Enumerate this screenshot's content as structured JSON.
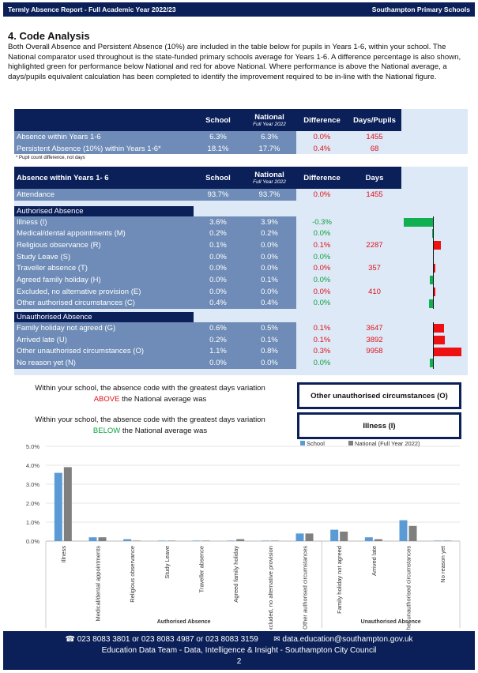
{
  "header": {
    "left": "Termly Absence Report - Full Academic Year 2022/23",
    "right": "Southampton Primary Schools"
  },
  "title": "4. Code Analysis",
  "intro": "Both Overall Absence and Persistent Absence (10%) are included in the table below for pupils in Years 1-6, within your school. The National comparator used throughout is the state-funded primary schools average for Years 1-6. A difference percentage is also shown, highlighted green for performance below National and red for above National. Where performance is above the National average, a days/pupils equivalent calculation has been completed to identify the improvement required to be in-line with the National figure.",
  "table1": {
    "headers": [
      "",
      "School",
      "National",
      "Difference",
      "Days/Pupils"
    ],
    "national_sub": "Full Year 2022",
    "rows": [
      {
        "label": "Absence within Years 1-6",
        "school": "6.3%",
        "national": "6.3%",
        "diff": "0.0%",
        "days": "1455",
        "status": "red"
      },
      {
        "label": "Persistent Absence (10%) within Years 1-6*",
        "school": "18.1%",
        "national": "17.7%",
        "diff": "0.4%",
        "days": "68",
        "status": "red"
      }
    ],
    "footnote": "* Pupil count difference, not days"
  },
  "table2": {
    "headers": [
      "Absence within Years 1- 6",
      "School",
      "National",
      "Difference",
      "Days"
    ],
    "national_sub": "Full Year 2022",
    "attendance": {
      "label": "Attendance",
      "school": "93.7%",
      "national": "93.7%",
      "diff": "0.0%",
      "days": "1455",
      "status": "red"
    },
    "authorised_title": "Authorised Absence",
    "authorised": [
      {
        "label": "Illness (I)",
        "school": "3.6%",
        "national": "3.9%",
        "diff": "-0.3%",
        "days": "",
        "status": "green",
        "bar": -0.3
      },
      {
        "label": "Medical/dental appointments (M)",
        "school": "0.2%",
        "national": "0.2%",
        "diff": "0.0%",
        "days": "",
        "status": "green",
        "bar": -0.005
      },
      {
        "label": "Religious observance (R)",
        "school": "0.1%",
        "national": "0.0%",
        "diff": "0.1%",
        "days": "2287",
        "status": "red",
        "bar": 0.07
      },
      {
        "label": "Study Leave (S)",
        "school": "0.0%",
        "national": "0.0%",
        "diff": "0.0%",
        "days": "",
        "status": "green",
        "bar": 0
      },
      {
        "label": "Traveller absence (T)",
        "school": "0.0%",
        "national": "0.0%",
        "diff": "0.0%",
        "days": "357",
        "status": "red",
        "bar": 0.01
      },
      {
        "label": "Agreed family holiday (H)",
        "school": "0.0%",
        "national": "0.1%",
        "diff": "0.0%",
        "days": "",
        "status": "green",
        "bar": -0.03
      },
      {
        "label": "Excluded, no alternative provision (E)",
        "school": "0.0%",
        "national": "0.0%",
        "diff": "0.0%",
        "days": "410",
        "status": "red",
        "bar": 0.01
      },
      {
        "label": "Other authorised circumstances (C)",
        "school": "0.4%",
        "national": "0.4%",
        "diff": "0.0%",
        "days": "",
        "status": "green",
        "bar": -0.04
      }
    ],
    "unauthorised_title": "Unauthorised Absence",
    "unauthorised": [
      {
        "label": "Family holiday not agreed (G)",
        "school": "0.6%",
        "national": "0.5%",
        "diff": "0.1%",
        "days": "3647",
        "status": "red",
        "bar": 0.1
      },
      {
        "label": "Arrived late (U)",
        "school": "0.2%",
        "national": "0.1%",
        "diff": "0.1%",
        "days": "3892",
        "status": "red",
        "bar": 0.11
      },
      {
        "label": "Other unauthorised circumstances (O)",
        "school": "1.1%",
        "national": "0.8%",
        "diff": "0.3%",
        "days": "9958",
        "status": "red",
        "bar": 0.28
      },
      {
        "label": "No reason yet (N)",
        "school": "0.0%",
        "national": "0.0%",
        "diff": "0.0%",
        "days": "",
        "status": "green",
        "bar": -0.03
      }
    ]
  },
  "callouts": {
    "line1": "Within your school, the absence code with the greatest days variation",
    "above_word": "ABOVE",
    "below_word": "BELOW",
    "tail": "the National average was",
    "above_value": "Other unauthorised circumstances (O)",
    "below_value": "Illness (I)"
  },
  "colors": {
    "navy": "#0b2059",
    "red": "#e0101a",
    "green": "#10a040",
    "school": "#5b9bd5",
    "national": "#7f7f7f"
  },
  "chart_data": {
    "type": "bar",
    "ylim": [
      0,
      5
    ],
    "yticks": [
      "0.0%",
      "1.0%",
      "2.0%",
      "3.0%",
      "4.0%",
      "5.0%"
    ],
    "categories": [
      "Illness",
      "Medical/dental appointments",
      "Religious observance",
      "Study Leave",
      "Traveller absence",
      "Agreed family holiday",
      "Excluded, no alternative provision",
      "Other authorised circumstances",
      "Family holiday not agreed",
      "Arrived late",
      "Other unauthorised circumstances",
      "No reason yet"
    ],
    "groups": [
      {
        "label": "Authorised Absence",
        "count": 8
      },
      {
        "label": "Unauthorised Absence",
        "count": 4
      }
    ],
    "series": [
      {
        "name": "School",
        "values": [
          3.6,
          0.2,
          0.1,
          0.0,
          0.0,
          0.0,
          0.0,
          0.4,
          0.6,
          0.2,
          1.1,
          0.0
        ]
      },
      {
        "name": "National (Full Year 2022)",
        "values": [
          3.9,
          0.2,
          0.0,
          0.0,
          0.0,
          0.1,
          0.0,
          0.4,
          0.5,
          0.1,
          0.8,
          0.0
        ]
      }
    ],
    "legend": "top-right",
    "grid": true
  },
  "footer": {
    "contact": "☎ 023 8083 3801 or 023 8083 4987 or 023 8083 3159       ✉ data.education@southampton.gov.uk",
    "team": "Education Data Team - Data, Intelligence & Insight - Southampton City Council",
    "page": "2"
  }
}
